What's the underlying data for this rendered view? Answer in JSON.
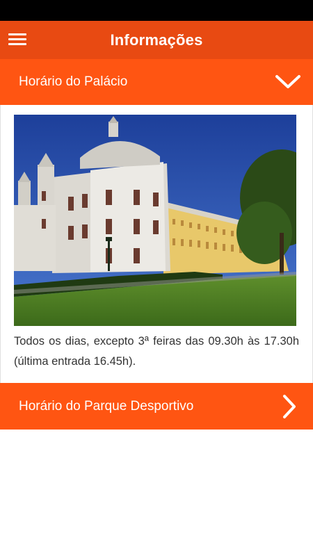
{
  "app_bar": {
    "title": "Informações",
    "menu_icon": "hamburger-menu-icon"
  },
  "sections": [
    {
      "label": "Horário do Palácio",
      "state": "expanded",
      "icon": "chevron-down-icon",
      "body_text": "Todos os dias, excepto 3ª feiras das 09.30h às 17.30h (última entrada 16.45h)."
    },
    {
      "label": "Horário do Parque Desportivo",
      "state": "collapsed",
      "icon": "chevron-right-icon"
    }
  ],
  "colors": {
    "app_bar": "#e84a12",
    "section_header": "#ff5512",
    "status_bar": "#000000",
    "text": "#333333"
  }
}
